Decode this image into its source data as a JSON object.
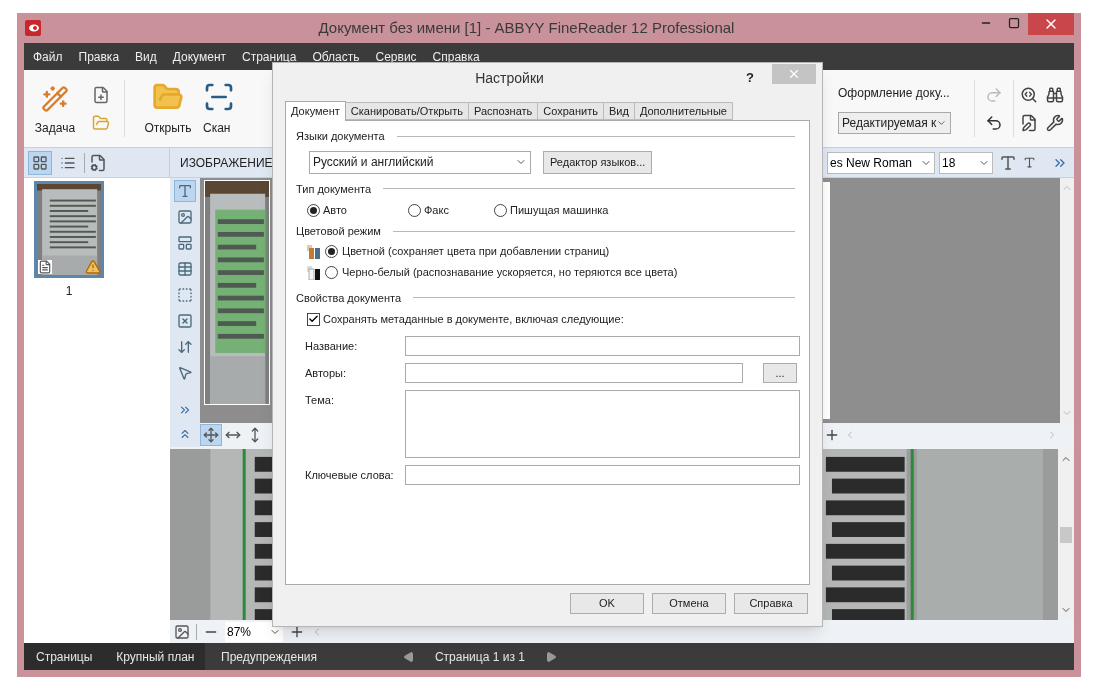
{
  "window": {
    "title": "Документ без имени [1] - ABBYY FineReader 12 Professional"
  },
  "menu": [
    "Файл",
    "Правка",
    "Вид",
    "Документ",
    "Страница",
    "Область",
    "Сервис",
    "Справка"
  ],
  "toolbar": {
    "task": "Задача",
    "open": "Открыть",
    "scan": "Скан",
    "layout_label": "Оформление доку...",
    "layout_select": "Редактируемая к"
  },
  "pane_views": [
    {
      "kind": "thumbnails",
      "selected": true
    },
    {
      "kind": "details",
      "selected": false
    }
  ],
  "pages": [
    {
      "number": "1",
      "selected": true,
      "warning": true
    }
  ],
  "image_panel": {
    "title": "ИЗОБРАЖЕНИЕ",
    "zoom": "87%"
  },
  "image_tools": [
    {
      "kind": "text-area",
      "selected": true
    },
    {
      "kind": "picture-area",
      "selected": false
    },
    {
      "kind": "mixed-area",
      "selected": false
    },
    {
      "kind": "table-area",
      "selected": false
    },
    {
      "kind": "background-area",
      "selected": false
    },
    {
      "kind": "delete-area",
      "selected": false
    },
    {
      "kind": "order-areas",
      "selected": false
    },
    {
      "kind": "pointer",
      "selected": false
    }
  ],
  "fit_modes": [
    {
      "kind": "fit-page",
      "selected": true
    },
    {
      "kind": "fit-width",
      "selected": false
    },
    {
      "kind": "fit-height",
      "selected": false
    }
  ],
  "text_panel": {
    "font": "es New Roman",
    "size": "18"
  },
  "bottom_tabs": [
    {
      "label": "Страницы"
    },
    {
      "label": "Крупный план"
    },
    {
      "label": "Предупреждения"
    }
  ],
  "page_nav": "Страница 1 из 1",
  "dialog": {
    "title": "Настройки",
    "help": "?",
    "tabs": [
      {
        "label": "Документ",
        "selected": true
      },
      {
        "label": "Сканировать/Открыть",
        "selected": false
      },
      {
        "label": "Распознать",
        "selected": false
      },
      {
        "label": "Сохранить",
        "selected": false
      },
      {
        "label": "Вид",
        "selected": false
      },
      {
        "label": "Дополнительные",
        "selected": false
      }
    ],
    "languages": {
      "heading": "Языки документа",
      "value": "Русский и английский",
      "editor_button": "Редактор языков..."
    },
    "doc_type": {
      "heading": "Тип документа",
      "options": [
        {
          "label": "Авто",
          "selected": true
        },
        {
          "label": "Факс",
          "selected": false
        },
        {
          "label": "Пишущая машинка",
          "selected": false
        }
      ]
    },
    "color_mode": {
      "heading": "Цветовой режим",
      "options": [
        {
          "label": "Цветной (сохраняет цвета при добавлении страниц)",
          "selected": true,
          "kind": "color"
        },
        {
          "label": "Черно-белый (распознавание ускоряется, но теряются все цвета)",
          "selected": false,
          "kind": "bw"
        }
      ]
    },
    "properties": {
      "heading": "Свойства документа",
      "save_metadata": {
        "label": "Сохранять метаданные в документе, включая следующие:",
        "checked": true
      },
      "fields": [
        {
          "label": "Название:",
          "kind": "line"
        },
        {
          "label": "Авторы:",
          "kind": "browse",
          "button": "..."
        },
        {
          "label": "Тема:",
          "kind": "area"
        },
        {
          "label": "Ключевые слова:",
          "kind": "line"
        }
      ]
    },
    "buttons": [
      "OK",
      "Отмена",
      "Справка"
    ]
  }
}
